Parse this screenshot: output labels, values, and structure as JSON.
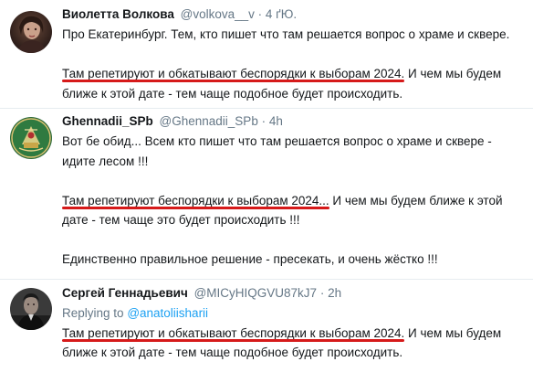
{
  "tweets": [
    {
      "name": "Виолетта Волкова",
      "handle": "@volkova__v",
      "dot": "·",
      "time": "4 ґЮ.",
      "lines": [
        "Про Екатеринбург. Тем, кто пишет что там решается вопрос о храме и сквере.",
        "",
        {
          "highlight": "Там репетируют и обкатывают беспорядки к выборам 2024.",
          "rest": " И чем мы будем"
        },
        "ближе к этой дате - тем чаще подобное будет происходить."
      ]
    },
    {
      "name": "Ghennadii_SPb",
      "handle": "@Ghennadii_SPb",
      "dot": "·",
      "time": "4h",
      "lines": [
        "Вот бе обид... Всем кто пишет что там решается вопрос о храме и сквере -",
        "идите лесом !!!",
        "",
        {
          "highlight": "Там репетируют беспорядки к выборам 2024...",
          "rest": " И чем мы будем ближе к этой"
        },
        "дате - тем чаще это будет происходить !!!",
        "",
        "Единственно правильное решение - пресекать, и очень жёстко !!!"
      ]
    },
    {
      "name": "Сергей Геннадьевич",
      "handle": "@MICyHIQGVU87kJ7",
      "dot": "·",
      "time": "2h",
      "replying_label": "Replying to",
      "replying_handle": "@anatoliisharii",
      "lines": [
        {
          "highlight": "Там репетируют и обкатывают беспорядки к выборам 2024.",
          "rest": " И чем мы будем"
        },
        "ближе к этой дате - тем чаще подобное будет происходить."
      ]
    }
  ],
  "colors": {
    "text": "#14171a",
    "muted": "#657786",
    "link": "#1da1f2",
    "underline": "#d61a1a",
    "divider": "#e6ecf0"
  }
}
